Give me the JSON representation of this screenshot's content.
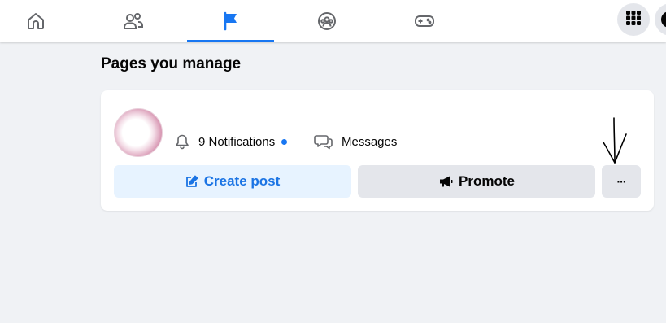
{
  "nav": {
    "tabs": [
      {
        "name": "home",
        "icon": "home-icon",
        "active": false
      },
      {
        "name": "friends",
        "icon": "friends-icon",
        "active": false
      },
      {
        "name": "pages",
        "icon": "flag-icon",
        "active": true
      },
      {
        "name": "groups",
        "icon": "groups-icon",
        "active": false
      },
      {
        "name": "gaming",
        "icon": "gamepad-icon",
        "active": false
      }
    ],
    "menu_icon": "grid-menu-icon",
    "accent_color": "#1877f2"
  },
  "main": {
    "title": "Pages you manage",
    "page_card": {
      "page_name": "",
      "notifications_label": "9 Notifications",
      "messages_label": "Messages",
      "create_post_label": "Create post",
      "promote_label": "Promote",
      "more_label": "···"
    }
  },
  "colors": {
    "background": "#f0f2f5",
    "create_button_bg": "#e7f3ff",
    "create_button_text": "#1b74e4",
    "secondary_button_bg": "#e4e6eb",
    "notification_dot": "#1877f2"
  }
}
